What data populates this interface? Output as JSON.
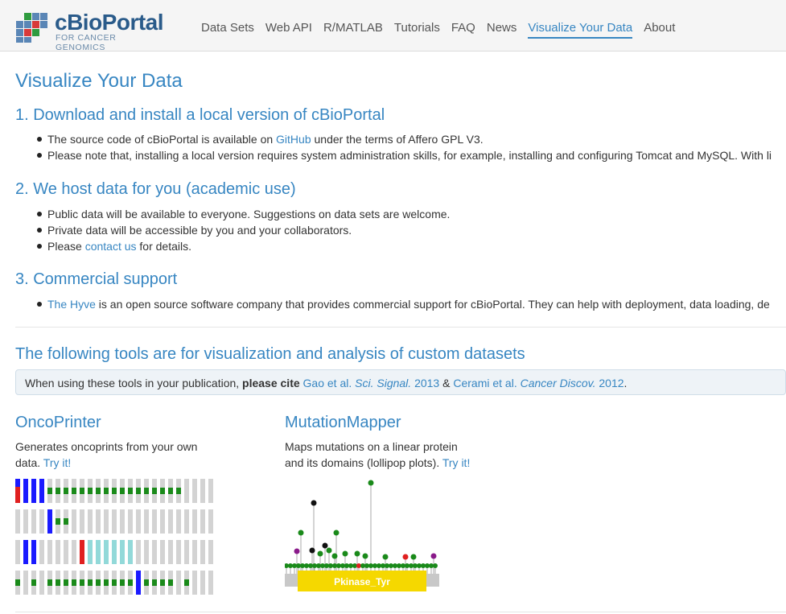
{
  "brand": {
    "name": "cBioPortal",
    "subtitle": "FOR CANCER GENOMICS"
  },
  "nav": {
    "items": [
      "Data Sets",
      "Web API",
      "R/MATLAB",
      "Tutorials",
      "FAQ",
      "News",
      "Visualize Your Data",
      "About"
    ],
    "active": "Visualize Your Data"
  },
  "page": {
    "title": "Visualize Your Data",
    "s1": {
      "heading": "1. Download and install a local version of cBioPortal",
      "b1_pre": "The source code of cBioPortal is available on ",
      "b1_link": "GitHub",
      "b1_post": " under the terms of Affero GPL V3.",
      "b2": "Please note that, installing a local version requires system administration skills, for example, installing and configuring Tomcat and MySQL. With li"
    },
    "s2": {
      "heading": "2. We host data for you (academic use)",
      "b1": "Public data will be available to everyone. Suggestions on data sets are welcome.",
      "b2": "Private data will be accessible by you and your collaborators.",
      "b3_pre": "Please ",
      "b3_link": "contact us",
      "b3_post": " for details."
    },
    "s3": {
      "heading": "3. Commercial support",
      "b1_link": "The Hyve",
      "b1_post": " is an open source software company that provides commercial support for cBioPortal. They can help with deployment, data loading, de"
    },
    "tools_heading": "The following tools are for visualization and analysis of custom datasets",
    "cite": {
      "pre": "When using these tools in your publication, ",
      "bold": "please cite",
      "ref1_a": "Gao et al.",
      "ref1_b": "Sci. Signal.",
      "ref1_c": "2013",
      "amp": " & ",
      "ref2_a": "Cerami et al.",
      "ref2_b": "Cancer Discov.",
      "ref2_c": "2012",
      "end": "."
    },
    "oncoprinter": {
      "title": "OncoPrinter",
      "desc1": "Generates oncoprints from your own",
      "desc2": "data.",
      "link": "Try it!"
    },
    "mutationmapper": {
      "title": "MutationMapper",
      "desc1": "Maps mutations on a linear protein",
      "desc2": "and its domains (lollipop plots).",
      "link": "Try it!",
      "domain_label": "Pkinase_Tyr"
    }
  },
  "colors": {
    "accent": "#3786c2",
    "blue_bar": "#1a1aff",
    "green": "#1a8a1a",
    "red": "#e02020",
    "cyan": "#92d9d9",
    "domain": "#f5d800"
  }
}
